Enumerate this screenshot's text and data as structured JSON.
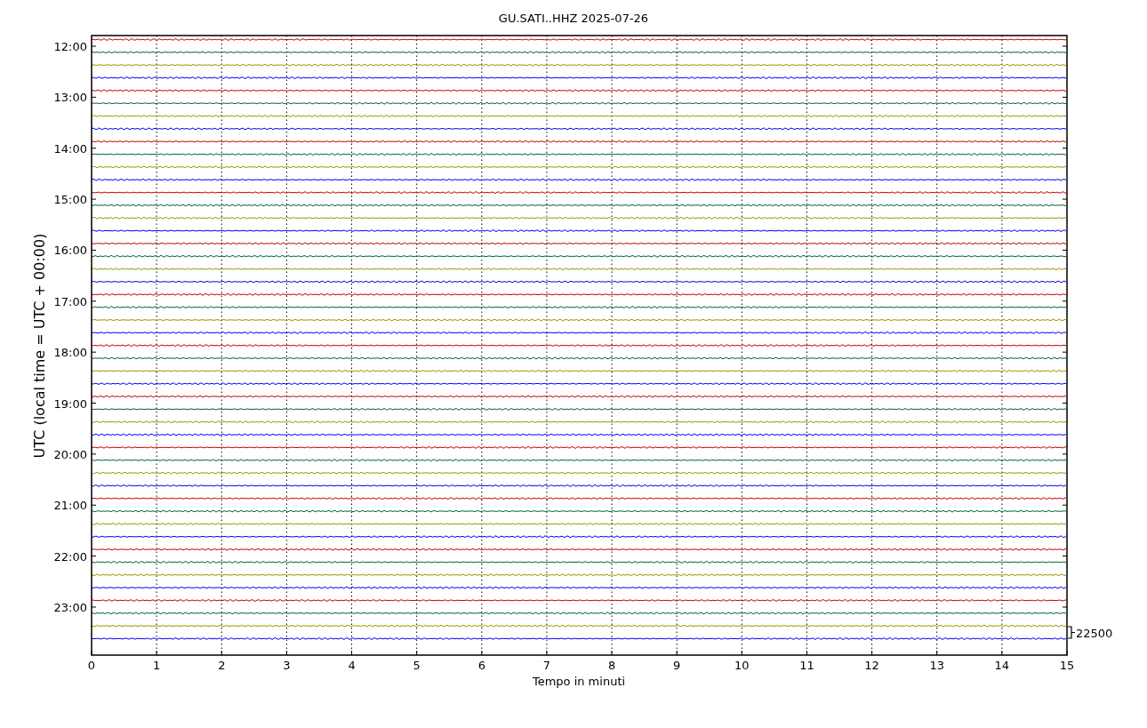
{
  "title": "GU.SATI..HHZ 2025-07-26",
  "ylabel": "UTC (local time = UTC + 00:00)",
  "xlabel": "Tempo in minuti",
  "xticks": [
    "0",
    "1",
    "2",
    "3",
    "4",
    "5",
    "6",
    "7",
    "8",
    "9",
    "10",
    "11",
    "12",
    "13",
    "14",
    "15"
  ],
  "yticks": [
    "12:00",
    "13:00",
    "14:00",
    "15:00",
    "16:00",
    "17:00",
    "18:00",
    "19:00",
    "20:00",
    "21:00",
    "22:00",
    "23:00"
  ],
  "scale_label": "22500",
  "traces": [
    {
      "color": "#cc0000"
    },
    {
      "color": "#006633"
    },
    {
      "color": "#999900"
    },
    {
      "color": "#0000ff"
    },
    {
      "color": "#cc0000"
    },
    {
      "color": "#006633"
    },
    {
      "color": "#999900"
    },
    {
      "color": "#0000ff"
    },
    {
      "color": "#cc0000"
    },
    {
      "color": "#006633"
    },
    {
      "color": "#999900"
    },
    {
      "color": "#0000ff"
    },
    {
      "color": "#cc0000"
    },
    {
      "color": "#006633"
    },
    {
      "color": "#999900"
    },
    {
      "color": "#0000ff"
    },
    {
      "color": "#cc0000"
    },
    {
      "color": "#006633"
    },
    {
      "color": "#999900"
    },
    {
      "color": "#0000ff"
    },
    {
      "color": "#cc0000"
    },
    {
      "color": "#006633"
    },
    {
      "color": "#999900"
    },
    {
      "color": "#0000ff"
    },
    {
      "color": "#cc0000"
    },
    {
      "color": "#006633"
    },
    {
      "color": "#999900"
    },
    {
      "color": "#0000ff"
    },
    {
      "color": "#cc0000"
    },
    {
      "color": "#006633"
    },
    {
      "color": "#999900"
    },
    {
      "color": "#0000ff"
    },
    {
      "color": "#cc0000"
    },
    {
      "color": "#006633"
    },
    {
      "color": "#999900"
    },
    {
      "color": "#0000ff"
    },
    {
      "color": "#cc0000"
    },
    {
      "color": "#006633"
    },
    {
      "color": "#999900"
    },
    {
      "color": "#0000ff"
    },
    {
      "color": "#cc0000"
    },
    {
      "color": "#006633"
    },
    {
      "color": "#999900"
    },
    {
      "color": "#0000ff"
    },
    {
      "color": "#cc0000"
    },
    {
      "color": "#006633"
    },
    {
      "color": "#999900"
    },
    {
      "color": "#0000ff"
    }
  ]
}
